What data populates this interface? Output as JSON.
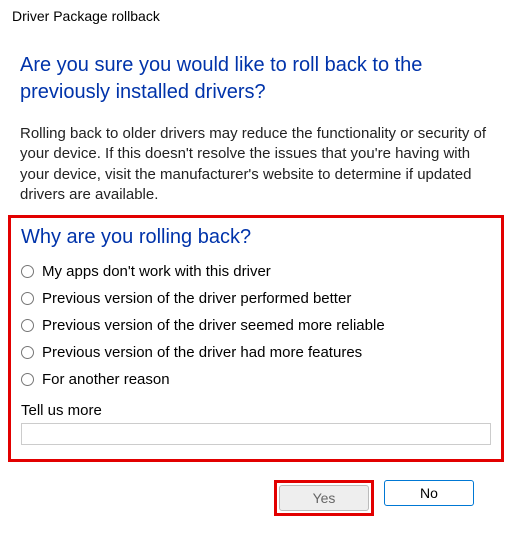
{
  "window": {
    "title": "Driver Package rollback"
  },
  "headings": {
    "main": "Are you sure you would like to roll back to the previously installed drivers?",
    "sub": "Why are you rolling back?"
  },
  "body": {
    "warning": "Rolling back to older drivers may reduce the functionality or security of your device. If this doesn't resolve the issues that you're having with your device, visit the manufacturer's website to determine if updated drivers are available."
  },
  "reasons": [
    "My apps don't work with this driver",
    "Previous version of the driver performed better",
    "Previous version of the driver seemed more reliable",
    "Previous version of the driver had more features",
    "For another reason"
  ],
  "tellus": {
    "label": "Tell us more",
    "value": ""
  },
  "buttons": {
    "yes": "Yes",
    "no": "No"
  }
}
